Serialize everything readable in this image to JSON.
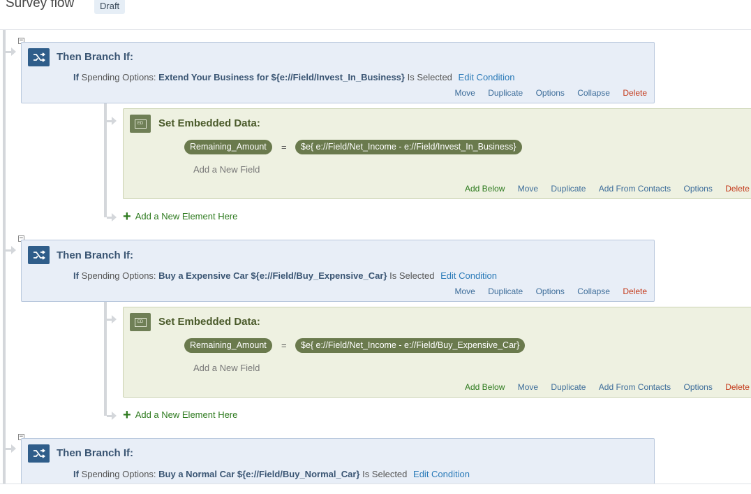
{
  "header": {
    "title": "Survey flow",
    "badge": "Draft"
  },
  "colors": {
    "branch_bg": "#e8eef7",
    "branch_icon": "#2f5d8a",
    "embedded_bg": "#eef1e1",
    "embedded_icon": "#6f7f56",
    "delete": "#c43a1b",
    "link": "#2a7ab8"
  },
  "branches": [
    {
      "collapse_symbol": "−",
      "title": "Then Branch If:",
      "condition": {
        "if_label": "If",
        "question": "Spending Options:",
        "choice": "Extend Your Business for ${e://Field/Invest_In_Business}",
        "operator": "Is Selected",
        "edit_label": "Edit Condition"
      },
      "actions": {
        "move": "Move",
        "duplicate": "Duplicate",
        "options": "Options",
        "collapse": "Collapse",
        "delete": "Delete"
      },
      "embedded": {
        "icon_text": "ED",
        "title": "Set Embedded Data:",
        "field": "Remaining_Amount",
        "equals": "=",
        "value": "$e{ e://Field/Net_Income - e://Field/Invest_In_Business}",
        "add_field": "Add a New Field",
        "actions": {
          "add_below": "Add Below",
          "move": "Move",
          "duplicate": "Duplicate",
          "add_from_contacts": "Add From Contacts",
          "options": "Options",
          "delete": "Delete"
        }
      },
      "add_element": {
        "plus": "+",
        "label": "Add a New Element Here"
      }
    },
    {
      "collapse_symbol": "−",
      "title": "Then Branch If:",
      "condition": {
        "if_label": "If",
        "question": "Spending Options:",
        "choice": "Buy a Expensive Car ${e://Field/Buy_Expensive_Car}",
        "operator": "Is Selected",
        "edit_label": "Edit Condition"
      },
      "actions": {
        "move": "Move",
        "duplicate": "Duplicate",
        "options": "Options",
        "collapse": "Collapse",
        "delete": "Delete"
      },
      "embedded": {
        "icon_text": "ED",
        "title": "Set Embedded Data:",
        "field": "Remaining_Amount",
        "equals": "=",
        "value": "$e{ e://Field/Net_Income - e://Field/Buy_Expensive_Car}",
        "add_field": "Add a New Field",
        "actions": {
          "add_below": "Add Below",
          "move": "Move",
          "duplicate": "Duplicate",
          "add_from_contacts": "Add From Contacts",
          "options": "Options",
          "delete": "Delete"
        }
      },
      "add_element": {
        "plus": "+",
        "label": "Add a New Element Here"
      }
    },
    {
      "collapse_symbol": "−",
      "title": "Then Branch If:",
      "condition": {
        "if_label": "If",
        "question": "Spending Options:",
        "choice": "Buy a Normal Car ${e://Field/Buy_Normal_Car}",
        "operator": "Is Selected",
        "edit_label": "Edit Condition"
      }
    }
  ]
}
